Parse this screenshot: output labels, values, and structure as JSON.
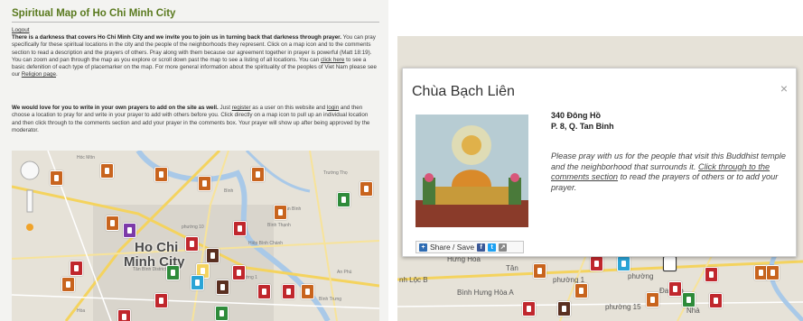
{
  "left": {
    "title": "Spiritual Map of Ho Chi Minh City",
    "logout": "Logout",
    "para1_bold": "There is a darkness that covers Ho Chi Minh City and we invite you to join us in turning back that darkness through prayer.",
    "para1_text": " You can pray specifically for these spiritual locations in the city and the people of the neighborhoods they represent. Click on a map icon and to the comments section to read a description and the prayers of others.  Pray along with them because our agreement together in prayer is powerful (Matt 18:19). You can zoom and pan through the map as you explore or scroll down past the map to see a listing of all locations.  You can ",
    "para1_link": "click here",
    "para1_text2": " to see a basic defenition of each type of placemarker on the map.  For more general information about the spirituality of the peoples of Viet Nam please see our ",
    "para1_link2": "Religion page",
    "para1_end": ".",
    "para2_bold": "We would love for you to write in your own prayers to add on the site as well.",
    "para2_text": "  Just ",
    "para2_link": "register",
    "para2_text2": " as a user on this website and ",
    "para2_link2": "login",
    "para2_text3": " and then choose a location to pray for and write in your prayer to add with others before you.  Click directly on a map icon to pull up an individual location and then click through to the comments section and add your prayer in the comments box.  Your prayer will show up after being approved by the moderator.",
    "map": {
      "city_label_1": "Ho Chi",
      "city_label_2": "Minh City",
      "labels": [
        "Hóc Môn",
        "Tân Bình District",
        "Bình Thạnh",
        "phường 10",
        "phường 1",
        "Hòa",
        "Bình",
        "Tân Bình",
        "Hiệp Bình Chánh",
        "Trường Thọ",
        "An Phú",
        "Bình Trưng"
      ]
    }
  },
  "popup": {
    "title": "Chùa Bạch Liên",
    "close": "×",
    "address_line1": "340 Đông Hồ",
    "address_line2": "P. 8, Q. Tan Binh",
    "prayer_text1": "Please pray with us for the people that visit this Buddhist temple and the neighborhood that surrounds it.  ",
    "prayer_link": "Click through to the comments section",
    "prayer_text2": " to read the prayers of others or to add your prayer.",
    "share_label": "Share / Save"
  },
  "right_map": {
    "labels": [
      "Hưng Hòa",
      "Tân",
      "phường 1",
      "Bình Hưng Hòa A",
      "phường 15",
      "Đa Kao",
      "phường",
      "Nhà",
      "nh Lộc B"
    ]
  },
  "colors": {
    "title_green": "#5a7a1f",
    "pin_orange": "#c8641e",
    "pin_red": "#c0272d",
    "pin_green": "#2e8b3a",
    "pin_blue": "#2aa4d6",
    "pin_brown": "#5a2f20",
    "road_yellow": "#f4d35e",
    "river_blue": "#a9c9e8"
  }
}
